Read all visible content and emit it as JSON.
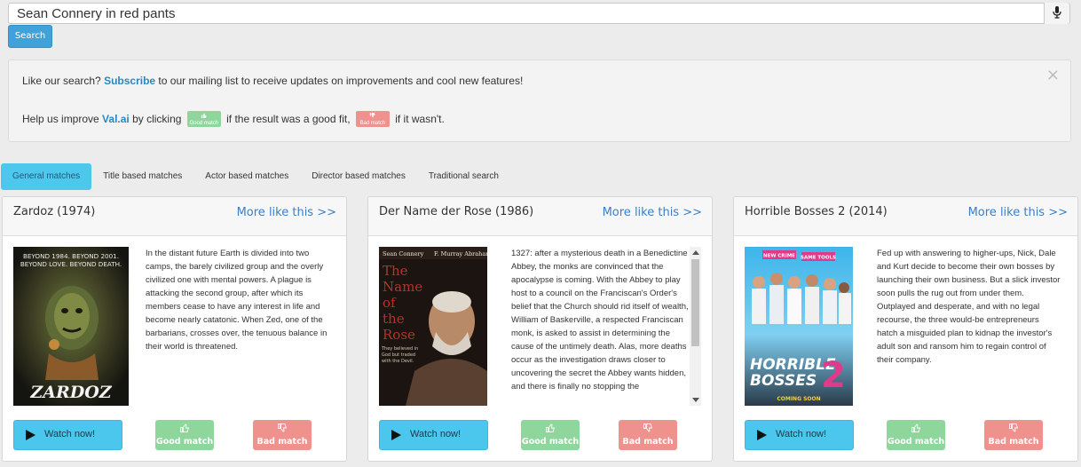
{
  "search": {
    "query": "Sean Connery in red pants",
    "button_label": "Search",
    "mic_icon": "microphone-icon"
  },
  "notice": {
    "close_label": "×",
    "line1_prefix": "Like our search? ",
    "subscribe_label": "Subscribe",
    "line1_suffix": " to our mailing list to receive updates on improvements and cool new features!",
    "line2_prefix": "Help us improve ",
    "brand": "Val.ai",
    "line2_mid1": " by clicking ",
    "good_badge": "Good match",
    "line2_mid2": " if the result was a good fit, ",
    "bad_badge": "Bad match",
    "line2_suffix": " if it wasn't."
  },
  "tabs": [
    {
      "label": "General matches",
      "active": true
    },
    {
      "label": "Title based matches",
      "active": false
    },
    {
      "label": "Actor based matches",
      "active": false
    },
    {
      "label": "Director based matches",
      "active": false
    },
    {
      "label": "Traditional search",
      "active": false
    }
  ],
  "cards": [
    {
      "title": "Zardoz (1974)",
      "more_label": "More like this >>",
      "poster_text": [
        "BEYOND 1984. BEYOND 2001.",
        "BEYOND LOVE. BEYOND DEATH.",
        "ZARDOZ"
      ],
      "description": "In the distant future Earth is divided into two camps, the barely civilized group and the overly civilized one with mental powers. A plague is attacking the second group, after which its members cease to have any interest in life and become nearly catatonic. When Zed, one of the barbarians, crosses over, the tenuous balance in their world is threatened.",
      "watch_label": "Watch now!",
      "good_label": "Good match",
      "bad_label": "Bad match"
    },
    {
      "title": "Der Name der Rose (1986)",
      "more_label": "More like this >>",
      "poster_text": [
        "Sean Connery",
        "F. Murray Abraham",
        "The",
        "Name",
        "of",
        "the",
        "Rose",
        "They believed in God but traded with the Devil."
      ],
      "description": "1327: after a mysterious death in a Benedictine Abbey, the monks are convinced that the apocalypse is coming. With the Abbey to play host to a council on the Franciscan's Order's belief that the Church should rid itself of wealth, William of Baskerville, a respected Franciscan monk, is asked to assist in determining the cause of the untimely death. Alas, more deaths occur as the investigation draws closer to uncovering the secret the Abbey wants hidden, and there is finally no stopping the",
      "watch_label": "Watch now!",
      "good_label": "Good match",
      "bad_label": "Bad match"
    },
    {
      "title": "Horrible Bosses 2 (2014)",
      "more_label": "More like this >>",
      "poster_text": [
        "NEW CRIME",
        "SAME TOOLS",
        "HORRIBLE",
        "BOSSES",
        "2",
        "COMING SOON"
      ],
      "description": "Fed up with answering to higher-ups, Nick, Dale and Kurt decide to become their own bosses by launching their own business. But a slick investor soon pulls the rug out from under them. Outplayed and desperate, and with no legal recourse, the three would-be entrepreneurs hatch a misguided plan to kidnap the investor's adult son and ransom him to regain control of their company.",
      "watch_label": "Watch now!",
      "good_label": "Good match",
      "bad_label": "Bad match"
    }
  ],
  "colors": {
    "accent": "#4bc7ee",
    "good": "#8fd69c",
    "bad": "#ef918c",
    "link": "#3a7fc6"
  }
}
